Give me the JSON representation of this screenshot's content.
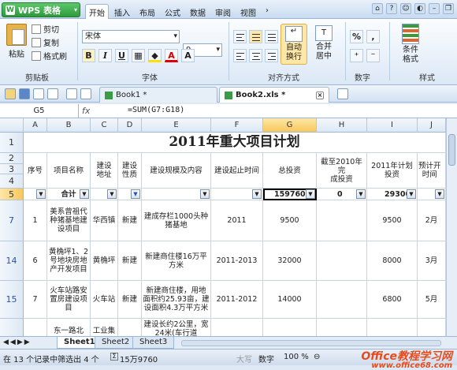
{
  "app": {
    "brand": "WPS 表格"
  },
  "menu_tabs": [
    "开始",
    "插入",
    "布局",
    "公式",
    "数据",
    "审阅",
    "视图"
  ],
  "ribbon": {
    "clipboard": {
      "paste": "粘贴",
      "cut": "剪切",
      "copy": "复制",
      "format_painter": "格式刷",
      "group_label": "剪贴板"
    },
    "font": {
      "name": "宋体",
      "size": "9",
      "bold": "B",
      "italic": "I",
      "underline": "U",
      "group_label": "字体"
    },
    "alignment": {
      "wrap": "自动换行",
      "merge": "合并居中",
      "group_label": "对齐方式"
    },
    "number": {
      "percent": "%",
      "comma": ",",
      "group_label": "数字"
    },
    "styles": {
      "conditional": "条件格式",
      "group_label": "样式"
    }
  },
  "doc_tabs": [
    {
      "label": "Book1 *"
    },
    {
      "label": "Book2.xls *"
    }
  ],
  "formula_bar": {
    "name_box": "G5",
    "fx": "fx",
    "formula": "=SUM(G7:G18)"
  },
  "columns": [
    "A",
    "B",
    "C",
    "D",
    "E",
    "F",
    "G",
    "H",
    "I",
    "J"
  ],
  "title": "2011年重大项目计划",
  "headers": [
    "序号",
    "项目名称",
    "建设地址",
    "建设性质",
    "建设规模及内容",
    "建设起止时间",
    "总投资",
    "截至2010年完成投资",
    "2011年计划投资",
    "预计开工时间"
  ],
  "header_display": [
    "序号",
    "项目名称",
    "建设\n地址",
    "建设\n性质",
    "建设规模及内容",
    "建设起止时间",
    "总投资",
    "截至2010年完\n成投资",
    "2011年计划\n投资",
    "预计开\n时间"
  ],
  "filter_row": {
    "label": "合计",
    "G": "159760",
    "H": "0",
    "I": "29300"
  },
  "rows": [
    {
      "row": "7",
      "A": "1",
      "B": "美系曾祖代种猪基地建设项目",
      "C": "华西镇",
      "D": "新建",
      "E": "建成存栏1000头种猪基地",
      "F": "2011",
      "G": "9500",
      "H": "",
      "I": "9500",
      "J": "2月"
    },
    {
      "row": "14",
      "A": "6",
      "B": "黄桷坪1、2号地块房地产开发项目",
      "C": "黄桷坪",
      "D": "新建",
      "E": "新建商住楼16万平方米",
      "F": "2011-2013",
      "G": "32000",
      "H": "",
      "I": "8000",
      "J": "3月"
    },
    {
      "row": "15",
      "A": "7",
      "B": "火车站路安置房建设项目",
      "C": "火车站",
      "D": "新建",
      "E": "新建商住楼，用地面积约25.93亩，建设面积4.3万平方米",
      "F": "2011-2012",
      "G": "14000",
      "H": "",
      "I": "6800",
      "J": "5月"
    },
    {
      "row": "",
      "A": "",
      "B": "东一路北",
      "C": "工业集",
      "D": "",
      "E": "建设长约2公里，宽24米(车行道",
      "F": "",
      "G": "",
      "H": "",
      "I": "",
      "J": ""
    }
  ],
  "sheets": [
    "Sheet1",
    "Sheet2",
    "Sheet3"
  ],
  "status": {
    "filter_text": "在 13 个记录中筛选出 4 个",
    "sum_text": "15万9760",
    "caps": "大写",
    "num": "数字",
    "zoom": "100 %"
  },
  "watermark": {
    "line1": "Office教程学习网",
    "line2": "www.office68.com"
  }
}
